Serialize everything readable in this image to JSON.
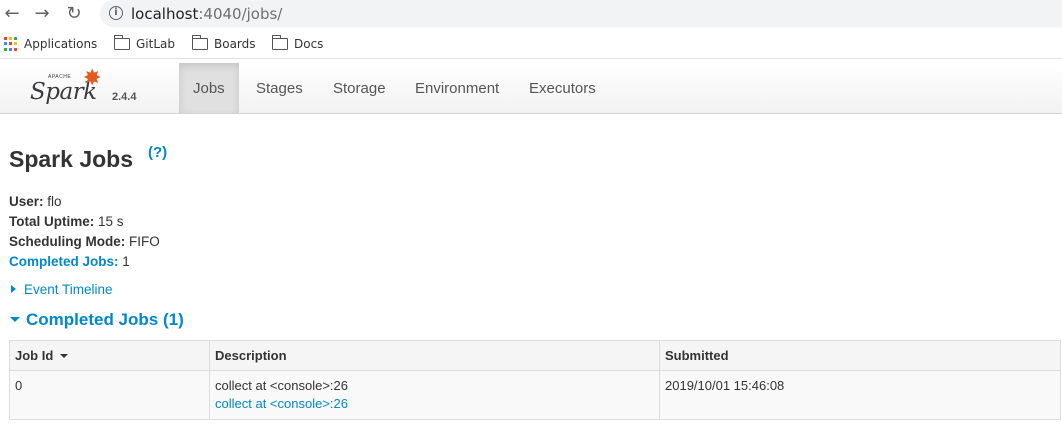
{
  "browser": {
    "url_host": "localhost",
    "url_path": ":4040/jobs/",
    "back_icon": "back-arrow-icon",
    "forward_icon": "forward-arrow-icon",
    "reload_icon": "reload-icon",
    "bookmarks": [
      {
        "label": "Applications",
        "icon": "apps-grid-icon"
      },
      {
        "label": "GitLab",
        "icon": "folder-icon"
      },
      {
        "label": "Boards",
        "icon": "folder-icon"
      },
      {
        "label": "Docs",
        "icon": "folder-icon"
      }
    ]
  },
  "navbar": {
    "logo_text": "Spark",
    "logo_small": "APACHE",
    "version": "2.4.4",
    "tabs": [
      {
        "label": "Jobs",
        "active": true
      },
      {
        "label": "Stages",
        "active": false
      },
      {
        "label": "Storage",
        "active": false
      },
      {
        "label": "Environment",
        "active": false
      },
      {
        "label": "Executors",
        "active": false
      }
    ]
  },
  "page": {
    "title": "Spark Jobs",
    "help": "(?)",
    "summary": {
      "user_label": "User:",
      "user_value": "flo",
      "uptime_label": "Total Uptime:",
      "uptime_value": "15 s",
      "mode_label": "Scheduling Mode:",
      "mode_value": "FIFO",
      "completed_label": "Completed Jobs:",
      "completed_value": "1"
    },
    "event_timeline": "Event Timeline",
    "completed_section": "Completed Jobs (1)",
    "table": {
      "headers": [
        "Job Id",
        "Description",
        "Submitted"
      ],
      "rows": [
        {
          "job_id": "0",
          "description": "collect at <console>:26",
          "description_link": "collect at <console>:26",
          "submitted": "2019/10/01 15:46:08"
        }
      ]
    }
  },
  "colors": {
    "link": "#0088cc",
    "spark_orange": "#e25a1c"
  }
}
